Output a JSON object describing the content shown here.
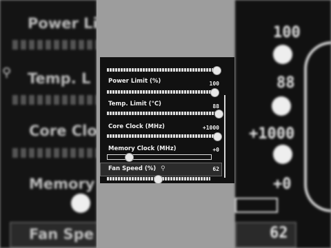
{
  "bg_left": {
    "labels": [
      "Power Lin",
      "Temp. L",
      "Core Cloc",
      "Memory",
      "Fan Spe"
    ]
  },
  "bg_right": {
    "values": [
      "100",
      "88",
      "+1000",
      "+0"
    ],
    "fan_value": "62"
  },
  "panel": {
    "rows": [
      {
        "label": "Power Limit (%)",
        "value": "100"
      },
      {
        "label": "Temp. Limit (°C)",
        "value": "88"
      },
      {
        "label": "Core Clock (MHz)",
        "value": "+1000"
      },
      {
        "label": "Memory Clock (MHz)",
        "value": "+0"
      },
      {
        "label": "Fan Speed (%)",
        "value": "62"
      }
    ]
  },
  "colors": {
    "panel_bg": "#111111",
    "text": "#f0f0f0",
    "accent_gray": "#9d9d9d"
  },
  "icons": [
    "link-icon",
    "slider-knob"
  ]
}
